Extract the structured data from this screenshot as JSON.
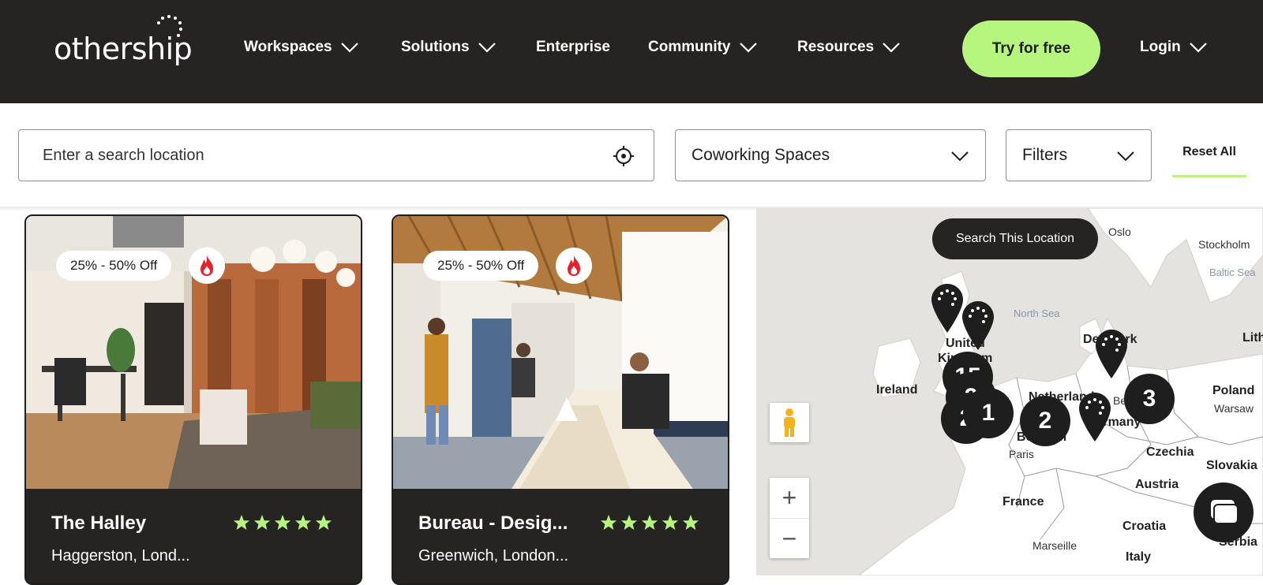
{
  "brand": {
    "logo_text": "othership"
  },
  "nav": {
    "items": [
      {
        "label": "Workspaces",
        "has_dropdown": true
      },
      {
        "label": "Solutions",
        "has_dropdown": true
      },
      {
        "label": "Enterprise",
        "has_dropdown": false
      },
      {
        "label": "Community",
        "has_dropdown": true
      },
      {
        "label": "Resources",
        "has_dropdown": true
      }
    ],
    "try_label": "Try for free",
    "login_label": "Login"
  },
  "search": {
    "placeholder": "Enter a search location",
    "type_value": "Coworking Spaces",
    "filters_label": "Filters",
    "reset_label": "Reset All"
  },
  "listings": [
    {
      "title": "The Halley",
      "location": "Haggerston, Lond...",
      "discount": "25% - 50% Off",
      "rating": 5
    },
    {
      "title": "Bureau - Desig...",
      "location": "Greenwich, London...",
      "discount": "25% - 50% Off",
      "rating": 5
    }
  ],
  "map": {
    "search_button": "Search This Location",
    "zoom_in": "+",
    "zoom_out": "−",
    "labels": {
      "oslo": "Oslo",
      "stockholm": "Stockholm",
      "baltic": "Baltic Sea",
      "north_sea": "North Sea",
      "united": "United",
      "kingdom": "Kingdom",
      "denmark": "Denmark",
      "lith": "Lith",
      "ireland": "Ireland",
      "netherlands": "Netherlands",
      "poland": "Poland",
      "warsaw": "Warsaw",
      "germany": "Germany",
      "belgium": "Belgium",
      "be": "Be",
      "paris": "Paris",
      "czechia": "Czechia",
      "slovakia": "Slovakia",
      "austria": "Austria",
      "france": "France",
      "croatia": "Croatia",
      "serbia": "Serbia",
      "marseille": "Marseille",
      "italy": "Italy"
    },
    "clusters": [
      "15",
      "2",
      "2",
      "1",
      "2",
      "3"
    ]
  },
  "colors": {
    "header_bg": "#262323",
    "accent": "#b6f57e",
    "star": "#b6f57e",
    "fire": "#e8202a"
  }
}
